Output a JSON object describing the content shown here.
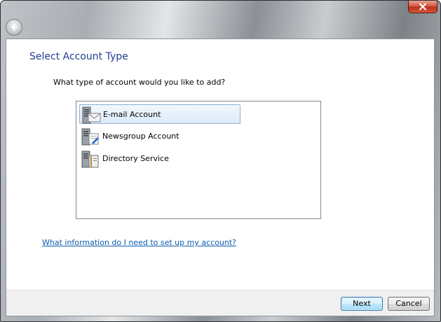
{
  "dialog": {
    "heading": "Select Account Type",
    "question": "What type of account would you like to add?",
    "help_link": "What information do I need to set up my account?"
  },
  "account_types": [
    {
      "label": "E-mail Account",
      "icon": "email-server-icon",
      "selected": true
    },
    {
      "label": "Newsgroup Account",
      "icon": "newsgroup-server-icon",
      "selected": false
    },
    {
      "label": "Directory Service",
      "icon": "directory-server-icon",
      "selected": false
    }
  ],
  "buttons": {
    "next_label": "Next",
    "cancel_label": "Cancel"
  },
  "colors": {
    "heading": "#1f3f8f",
    "link": "#0b5cad",
    "selection": "#dbeaf9"
  }
}
